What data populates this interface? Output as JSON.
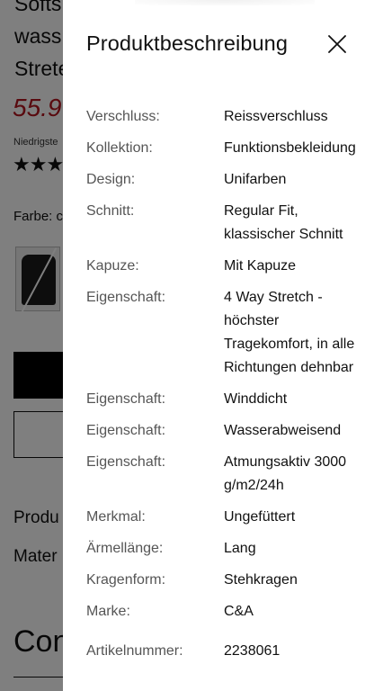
{
  "background": {
    "title_lines": [
      "Softs",
      "wass",
      "Strete"
    ],
    "price": "55.9",
    "lowest_price_label": "Niedrigste",
    "rating_stars": "★★★",
    "color_label": "Farbe: c",
    "buttons": [
      "",
      ""
    ],
    "links": [
      "Produ",
      "Mater"
    ],
    "section_heading": "Con"
  },
  "drawer": {
    "title": "Produktbeschreibung",
    "close_icon": "close-icon",
    "specs": [
      {
        "key": "Verschluss:",
        "value": "Reissverschluss"
      },
      {
        "key": "Kollektion:",
        "value": "Funktionsbekleidung"
      },
      {
        "key": "Design:",
        "value": "Unifarben"
      },
      {
        "key": "Schnitt:",
        "value": "Regular Fit, klassischer Schnitt"
      },
      {
        "key": "Kapuze:",
        "value": "Mit Kapuze"
      },
      {
        "key": "Eigenschaft:",
        "value": "4 Way Stretch - höchster Tragekomfort, in alle Richtungen dehnbar"
      },
      {
        "key": "Eigenschaft:",
        "value": "Winddicht"
      },
      {
        "key": "Eigenschaft:",
        "value": "Wasserabweisend"
      },
      {
        "key": "Eigenschaft:",
        "value": "Atmungsaktiv 3000 g/m2/24h"
      },
      {
        "key": "Merkmal:",
        "value": "Ungefüttert"
      },
      {
        "key": "Ärmellänge:",
        "value": "Lang"
      },
      {
        "key": "Kragenform:",
        "value": "Stehkragen"
      },
      {
        "key": "Marke:",
        "value": "C&A"
      }
    ],
    "article_number": {
      "key": "Artikelnummer:",
      "value": "2238061"
    }
  }
}
